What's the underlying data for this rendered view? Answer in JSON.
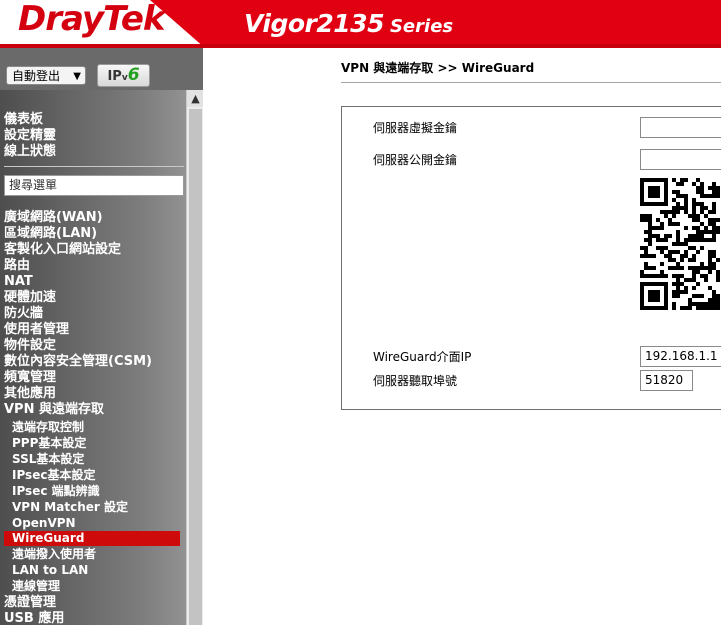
{
  "header": {
    "brand": "DrayTek",
    "model": "Vigor2135",
    "series": "Series"
  },
  "sidebar": {
    "language": "自動登出",
    "ipv6_badge_prefix": "IP",
    "ipv6_badge_v": "v",
    "ipv6_badge_six": "6",
    "top_items": [
      "儀表板",
      "設定精靈",
      "線上狀態"
    ],
    "search_placeholder": "搜尋選單",
    "items": [
      "廣域網路(WAN)",
      "區域網路(LAN)",
      "客製化入口網站設定",
      "路由",
      "NAT",
      "硬體加速",
      "防火牆",
      "使用者管理",
      "物件設定",
      "數位內容安全管理(CSM)",
      "頻寬管理",
      "其他應用",
      "VPN 與遠端存取"
    ],
    "vpn_subitems": [
      "遠端存取控制",
      "PPP基本設定",
      "SSL基本設定",
      "IPsec基本設定",
      "IPsec 端點辨識",
      "VPN Matcher 設定",
      "OpenVPN",
      "WireGuard",
      "遠端撥入使用者",
      "LAN to LAN",
      "連線管理"
    ],
    "active_item": "WireGuard",
    "bottom_items": [
      "憑證管理",
      "USB 應用"
    ]
  },
  "main": {
    "breadcrumb": "VPN 與遠端存取 >> WireGuard",
    "fields": {
      "private_key_label": "伺服器虛擬金鑰",
      "private_key_value": "",
      "public_key_label": "伺服器公開金鑰",
      "public_key_value": "",
      "interface_ip_label": "WireGuard介面IP",
      "interface_ip_value": "192.168.1.1",
      "listen_port_label": "伺服器聽取埠號",
      "listen_port_value": "51820"
    }
  }
}
